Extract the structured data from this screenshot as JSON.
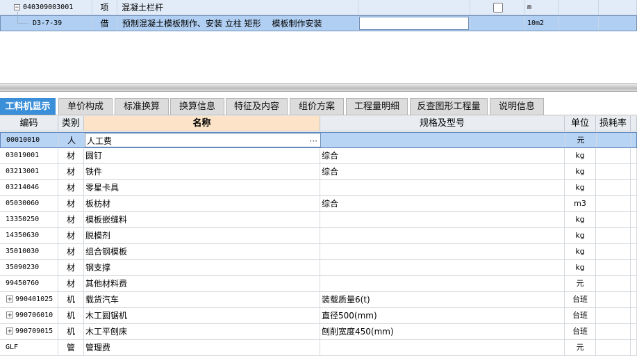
{
  "top_rows": [
    {
      "code": "040309003001",
      "type": "项",
      "name": "混凝土栏杆",
      "unit": "m",
      "expander": "−"
    },
    {
      "code": "D3-7-39",
      "type": "借",
      "name": "预制混凝土模板制作、安装 立柱 矩形　 模板制作安装",
      "unit": "10m2"
    }
  ],
  "tabs": [
    "工料机显示",
    "单价构成",
    "标准换算",
    "换算信息",
    "特征及内容",
    "组价方案",
    "工程量明细",
    "反查图形工程量",
    "说明信息"
  ],
  "columns": {
    "code": "编码",
    "type": "类别",
    "name": "名称",
    "spec": "规格及型号",
    "unit": "单位",
    "loss": "损耗率"
  },
  "rows": [
    {
      "code": "00010010",
      "type": "人",
      "name": "人工费",
      "spec": "",
      "unit": "元"
    },
    {
      "code": "03019001",
      "type": "材",
      "name": "圆钉",
      "spec": "综合",
      "unit": "kg"
    },
    {
      "code": "03213001",
      "type": "材",
      "name": "铁件",
      "spec": "综合",
      "unit": "kg"
    },
    {
      "code": "03214046",
      "type": "材",
      "name": "零星卡具",
      "spec": "",
      "unit": "kg"
    },
    {
      "code": "05030060",
      "type": "材",
      "name": "板枋材",
      "spec": "综合",
      "unit": "m3"
    },
    {
      "code": "13350250",
      "type": "材",
      "name": "模板嵌缝料",
      "spec": "",
      "unit": "kg"
    },
    {
      "code": "14350630",
      "type": "材",
      "name": "脱模剂",
      "spec": "",
      "unit": "kg"
    },
    {
      "code": "35010030",
      "type": "材",
      "name": "组合钢模板",
      "spec": "",
      "unit": "kg"
    },
    {
      "code": "35090230",
      "type": "材",
      "name": "钢支撑",
      "spec": "",
      "unit": "kg"
    },
    {
      "code": "99450760",
      "type": "材",
      "name": "其他材料费",
      "spec": "",
      "unit": "元"
    },
    {
      "code": "990401025",
      "type": "机",
      "name": "载货汽车",
      "spec": "装载质量6(t)",
      "unit": "台班",
      "expander": "+"
    },
    {
      "code": "990706010",
      "type": "机",
      "name": "木工圆锯机",
      "spec": "直径500(mm)",
      "unit": "台班",
      "expander": "+"
    },
    {
      "code": "990709015",
      "type": "机",
      "name": "木工平刨床",
      "spec": "刨削宽度450(mm)",
      "unit": "台班",
      "expander": "+"
    },
    {
      "code": "GLF",
      "type": "管",
      "name": "管理费",
      "spec": "",
      "unit": "元"
    }
  ],
  "ellipsis": "···"
}
